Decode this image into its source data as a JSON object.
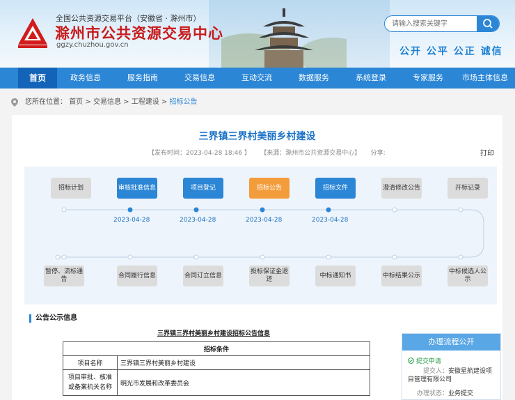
{
  "header": {
    "platform": "全国公共资源交易平台（安徽省 · 滁州市）",
    "site_name": "滁州市公共资源交易中心",
    "site_url": "ggzy.chuzhou.gov.cn",
    "search_placeholder": "请输入搜索关键字",
    "slogan": "公开 公平 公正 诚信"
  },
  "nav": [
    "首页",
    "政务信息",
    "服务指南",
    "交易信息",
    "互动交流",
    "数据服务",
    "系统登录",
    "专家服务",
    "市场主体信息"
  ],
  "breadcrumb": {
    "prefix": "您所在位置：",
    "items": [
      "首页",
      ">",
      "交易信息",
      ">",
      "工程建设",
      ">"
    ],
    "current": "招标公告"
  },
  "article": {
    "title": "三界镇三界村美丽乡村建设",
    "publish": "【发布时间：2023-04-28 18:46 】",
    "source": "【来源：滁州市公共资源交易中心】",
    "share": "分享:",
    "print": "打印"
  },
  "flow": {
    "top_steps": [
      {
        "label": "招标计划",
        "state": "off"
      },
      {
        "label": "审核批准信息",
        "state": "on"
      },
      {
        "label": "项目登记",
        "state": "on"
      },
      {
        "label": "招标公告",
        "state": "active"
      },
      {
        "label": "招标文件",
        "state": "on"
      },
      {
        "label": "澄清修改公告",
        "state": "off"
      },
      {
        "label": "开标记录",
        "state": "off"
      }
    ],
    "dates": [
      "2023-04-28",
      "2023-04-28",
      "2023-04-28",
      "2023-04-28"
    ],
    "bottom_steps": [
      "暂停、流标通告",
      "合同履行信息",
      "合同订立信息",
      "投标保证金退还",
      "中标通知书",
      "中标结果公示",
      "中标候选人公示"
    ],
    "colors": {
      "on": "#2b86d6",
      "active": "#f39c3c",
      "off": "#dcdcdc"
    }
  },
  "section": {
    "heading": "公告公示信息",
    "doc_title": "三界镇三界村美丽乡村建设招标公告信息",
    "table_header": "招标条件",
    "rows": [
      {
        "key": "项目名称",
        "value": "三界镇三界村美丽乡村建设"
      },
      {
        "key": "项目审批、核准或备案机关名称",
        "value": "明光市发展和改革委员会"
      }
    ]
  },
  "sidebar": {
    "title": "办理流程公开",
    "status_label": "提交申请",
    "submitter_label": "提交人：",
    "submitter": "安徽星航建设项目管理有限公司",
    "state_label": "办理状态：",
    "state": "业务提交"
  }
}
